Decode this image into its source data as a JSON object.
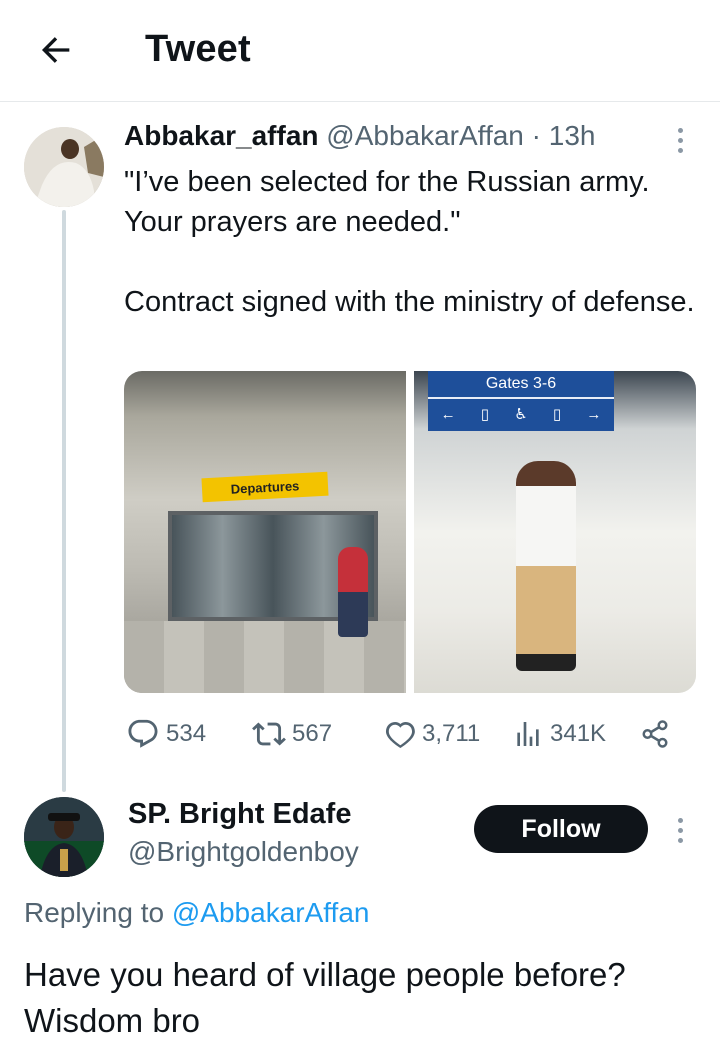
{
  "header": {
    "title": "Tweet",
    "back_icon": "arrow-left-icon"
  },
  "tweet": {
    "author_name": "Abbakar_affan",
    "author_handle": "@AbbakarAffan",
    "separator": "·",
    "time": "13h",
    "text_lines": [
      "\"I’ve been selected for the Russian army. Your prayers are needed.\"",
      "Contract signed with the ministry of defense."
    ],
    "media": {
      "photo1_sign": "Departures",
      "photo2_sign": "Gates 3-6"
    },
    "stats": {
      "replies": "534",
      "retweets": "567",
      "likes": "3,711",
      "views": "341K"
    }
  },
  "reply": {
    "author_name": "SP. Bright Edafe",
    "author_handle": "@Brightgoldenboy",
    "follow_label": "Follow",
    "replying_prefix": "Replying to",
    "replying_mention": "@AbbakarAffan",
    "text_lines": [
      "Have you heard of village people before?",
      "Wisdom bro"
    ]
  },
  "colors": {
    "text": "#0f1419",
    "secondary": "#536471",
    "link": "#1d9bf0",
    "button_bg": "#0f1419"
  }
}
